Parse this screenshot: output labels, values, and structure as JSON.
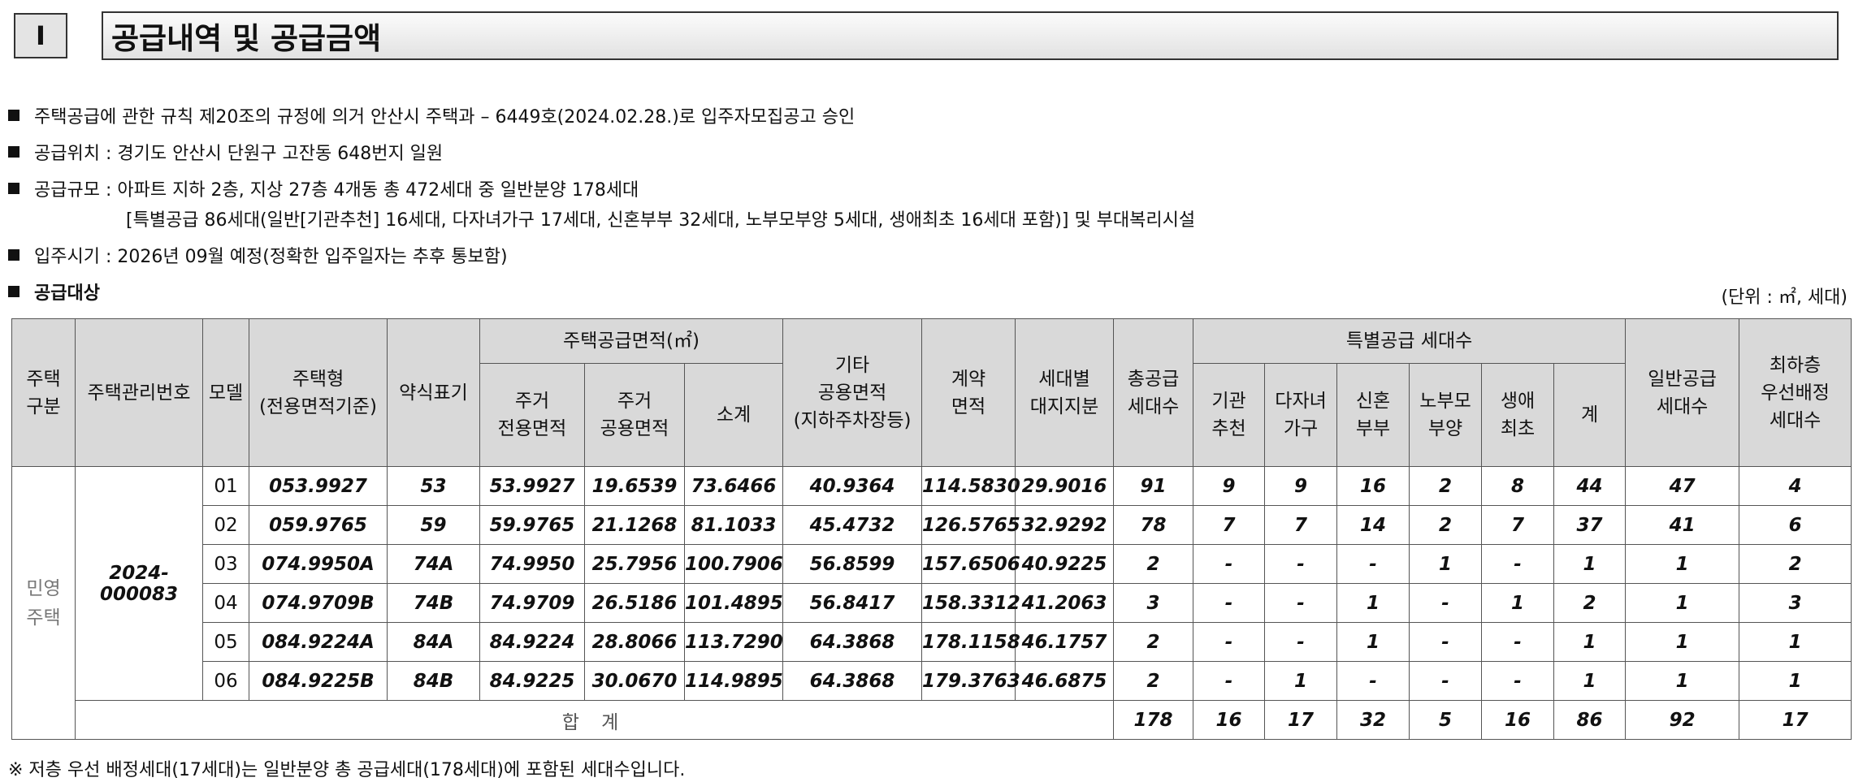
{
  "section": {
    "number": "I",
    "title": "공급내역 및 공급금액"
  },
  "bullets": [
    "주택공급에 관한 규칙 제20조의 규정에 의거 안산시 주택과 – 6449호(2024.02.28.)로 입주자모집공고 승인",
    "공급위치 : 경기도 안산시 단원구 고잔동 648번지 일원",
    "공급규모 : 아파트 지하 2층, 지상 27층 4개동 총 472세대 중 일반분양 178세대",
    "입주시기 : 2026년 09월 예정(정확한 입주일자는 추후 통보함)",
    "공급대상"
  ],
  "scale_detail": "[특별공급 86세대(일반[기관추천] 16세대, 다자녀가구 17세대, 신혼부부 32세대, 노부모부양 5세대, 생애최초 16세대 포함)] 및 부대복리시설",
  "unit_label": "(단위 : ㎡, 세대)",
  "table": {
    "headers": {
      "house_kind": "주택\n구분",
      "mgmt_no": "주택관리번호",
      "model": "모델",
      "house_type": "주택형\n(전용면적기준)",
      "abbrev": "약식표기",
      "supply_area": "주택공급면적(㎡)",
      "exclusive": "주거\n전용면적",
      "common": "주거\n공용면적",
      "subtotal": "소계",
      "other_common": "기타\n공용면적\n(지하주차장등)",
      "contract_area": "계약\n면적",
      "land_share": "세대별\n대지지분",
      "total_supply": "총공급\n세대수",
      "special": "특별공급 세대수",
      "inst": "기관\n추천",
      "multi": "다자녀\n가구",
      "newlywed": "신혼\n부부",
      "elderly": "노부모\n부양",
      "first": "생애\n최초",
      "special_sum": "계",
      "general": "일반공급\n세대수",
      "lowest": "최하층\n우선배정\n세대수"
    },
    "house_kind": "민영\n주택",
    "mgmt_no": "2024- 000083",
    "rows": [
      {
        "model": "01",
        "type": "053.9927",
        "abbr": "53",
        "excl": "53.9927",
        "comm": "19.6539",
        "sub": "73.6466",
        "other": "40.9364",
        "contract": "114.5830",
        "land": "29.9016",
        "total": "91",
        "inst": "9",
        "multi": "9",
        "newly": "16",
        "elder": "2",
        "first": "8",
        "sp_sum": "44",
        "general": "47",
        "lowest": "4"
      },
      {
        "model": "02",
        "type": "059.9765",
        "abbr": "59",
        "excl": "59.9765",
        "comm": "21.1268",
        "sub": "81.1033",
        "other": "45.4732",
        "contract": "126.5765",
        "land": "32.9292",
        "total": "78",
        "inst": "7",
        "multi": "7",
        "newly": "14",
        "elder": "2",
        "first": "7",
        "sp_sum": "37",
        "general": "41",
        "lowest": "6"
      },
      {
        "model": "03",
        "type": "074.9950A",
        "abbr": "74A",
        "excl": "74.9950",
        "comm": "25.7956",
        "sub": "100.7906",
        "other": "56.8599",
        "contract": "157.6506",
        "land": "40.9225",
        "total": "2",
        "inst": "-",
        "multi": "-",
        "newly": "-",
        "elder": "1",
        "first": "-",
        "sp_sum": "1",
        "general": "1",
        "lowest": "2"
      },
      {
        "model": "04",
        "type": "074.9709B",
        "abbr": "74B",
        "excl": "74.9709",
        "comm": "26.5186",
        "sub": "101.4895",
        "other": "56.8417",
        "contract": "158.3312",
        "land": "41.2063",
        "total": "3",
        "inst": "-",
        "multi": "-",
        "newly": "1",
        "elder": "-",
        "first": "1",
        "sp_sum": "2",
        "general": "1",
        "lowest": "3"
      },
      {
        "model": "05",
        "type": "084.9224A",
        "abbr": "84A",
        "excl": "84.9224",
        "comm": "28.8066",
        "sub": "113.7290",
        "other": "64.3868",
        "contract": "178.1158",
        "land": "46.1757",
        "total": "2",
        "inst": "-",
        "multi": "-",
        "newly": "1",
        "elder": "-",
        "first": "-",
        "sp_sum": "1",
        "general": "1",
        "lowest": "1"
      },
      {
        "model": "06",
        "type": "084.9225B",
        "abbr": "84B",
        "excl": "84.9225",
        "comm": "30.0670",
        "sub": "114.9895",
        "other": "64.3868",
        "contract": "179.3763",
        "land": "46.6875",
        "total": "2",
        "inst": "-",
        "multi": "1",
        "newly": "-",
        "elder": "-",
        "first": "-",
        "sp_sum": "1",
        "general": "1",
        "lowest": "1"
      }
    ],
    "sum_row": {
      "label": "합 계",
      "total": "178",
      "inst": "16",
      "multi": "17",
      "newly": "32",
      "elder": "5",
      "first": "16",
      "sp_sum": "86",
      "general": "92",
      "lowest": "17"
    }
  },
  "footnote": "※ 저층 우선 배정세대(17세대)는 일반분양 총 공급세대(178세대)에 포함된 세대수입니다."
}
